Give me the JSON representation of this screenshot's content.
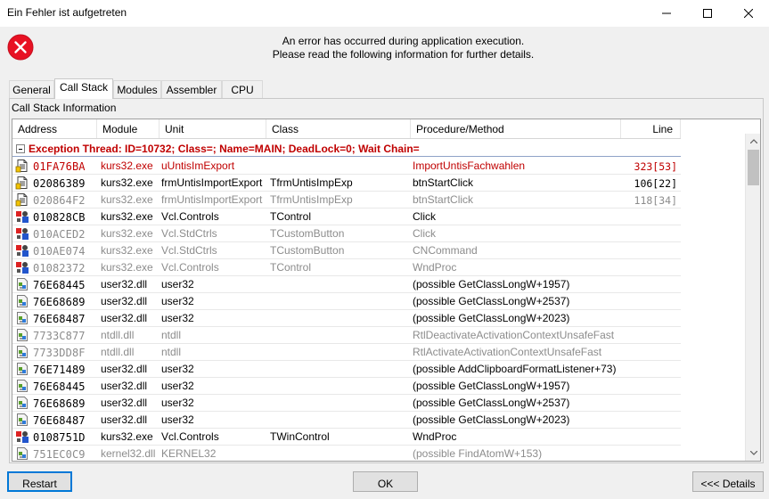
{
  "window": {
    "title": "Ein Fehler ist aufgetreten"
  },
  "message": {
    "line1": "An error has occurred during application execution.",
    "line2": "Please read the following information for further details."
  },
  "tabs": [
    {
      "label": "General"
    },
    {
      "label": "Call Stack"
    },
    {
      "label": "Modules"
    },
    {
      "label": "Assembler"
    },
    {
      "label": "CPU"
    }
  ],
  "section_label": "Call Stack Information",
  "columns": [
    "Address",
    "Module",
    "Unit",
    "Class",
    "Procedure/Method",
    "Line"
  ],
  "thread_header": "Exception Thread: ID=10732; Class=; Name=MAIN; DeadLock=0; Wait Chain=",
  "rows": [
    {
      "icon": "source-icon",
      "style": "red",
      "address": "01FA76BA",
      "module": "kurs32.exe",
      "unit": "uUntisImExport",
      "class": "",
      "proc": "ImportUntisFachwahlen",
      "line": "323[53]"
    },
    {
      "icon": "source-icon",
      "style": "normal",
      "address": "02086389",
      "module": "kurs32.exe",
      "unit": "frmUntisImportExport",
      "class": "TfrmUntisImpExp",
      "proc": "btnStartClick",
      "line": "106[22]"
    },
    {
      "icon": "source-icon",
      "style": "gray",
      "address": "020864F2",
      "module": "kurs32.exe",
      "unit": "frmUntisImportExport",
      "class": "TfrmUntisImpExp",
      "proc": "btnStartClick",
      "line": "118[34]"
    },
    {
      "icon": "vcl-icon",
      "style": "normal",
      "address": "010828CB",
      "module": "kurs32.exe",
      "unit": "Vcl.Controls",
      "class": "TControl",
      "proc": "Click",
      "line": ""
    },
    {
      "icon": "vcl-icon",
      "style": "gray",
      "address": "010ACED2",
      "module": "kurs32.exe",
      "unit": "Vcl.StdCtrls",
      "class": "TCustomButton",
      "proc": "Click",
      "line": ""
    },
    {
      "icon": "vcl-icon",
      "style": "gray",
      "address": "010AE074",
      "module": "kurs32.exe",
      "unit": "Vcl.StdCtrls",
      "class": "TCustomButton",
      "proc": "CNCommand",
      "line": ""
    },
    {
      "icon": "vcl-icon",
      "style": "gray",
      "address": "01082372",
      "module": "kurs32.exe",
      "unit": "Vcl.Controls",
      "class": "TControl",
      "proc": "WndProc",
      "line": ""
    },
    {
      "icon": "dll-icon",
      "style": "normal",
      "address": "76E68445",
      "module": "user32.dll",
      "unit": "user32",
      "class": "",
      "proc": " (possible GetClassLongW+1957)",
      "line": ""
    },
    {
      "icon": "dll-icon",
      "style": "normal",
      "address": "76E68689",
      "module": "user32.dll",
      "unit": "user32",
      "class": "",
      "proc": " (possible GetClassLongW+2537)",
      "line": ""
    },
    {
      "icon": "dll-icon",
      "style": "normal",
      "address": "76E68487",
      "module": "user32.dll",
      "unit": "user32",
      "class": "",
      "proc": " (possible GetClassLongW+2023)",
      "line": ""
    },
    {
      "icon": "dll-icon",
      "style": "gray",
      "address": "7733C877",
      "module": "ntdll.dll",
      "unit": "ntdll",
      "class": "",
      "proc": "RtlDeactivateActivationContextUnsafeFast",
      "line": ""
    },
    {
      "icon": "dll-icon",
      "style": "gray",
      "address": "7733DD8F",
      "module": "ntdll.dll",
      "unit": "ntdll",
      "class": "",
      "proc": "RtlActivateActivationContextUnsafeFast",
      "line": ""
    },
    {
      "icon": "dll-icon",
      "style": "normal",
      "address": "76E71489",
      "module": "user32.dll",
      "unit": "user32",
      "class": "",
      "proc": " (possible AddClipboardFormatListener+73)",
      "line": ""
    },
    {
      "icon": "dll-icon",
      "style": "normal",
      "address": "76E68445",
      "module": "user32.dll",
      "unit": "user32",
      "class": "",
      "proc": " (possible GetClassLongW+1957)",
      "line": ""
    },
    {
      "icon": "dll-icon",
      "style": "normal",
      "address": "76E68689",
      "module": "user32.dll",
      "unit": "user32",
      "class": "",
      "proc": " (possible GetClassLongW+2537)",
      "line": ""
    },
    {
      "icon": "dll-icon",
      "style": "normal",
      "address": "76E68487",
      "module": "user32.dll",
      "unit": "user32",
      "class": "",
      "proc": " (possible GetClassLongW+2023)",
      "line": ""
    },
    {
      "icon": "vcl-icon",
      "style": "normal",
      "address": "0108751D",
      "module": "kurs32.exe",
      "unit": "Vcl.Controls",
      "class": "TWinControl",
      "proc": "WndProc",
      "line": ""
    },
    {
      "icon": "dll-icon",
      "style": "gray",
      "address": "751EC0C9",
      "module": "kernel32.dll",
      "unit": "KERNEL32",
      "class": "",
      "proc": " (possible FindAtomW+153)",
      "line": ""
    }
  ],
  "buttons": {
    "restart": "Restart",
    "ok": "OK",
    "details": "<<< Details"
  },
  "colors": {
    "error_red": "#c00000",
    "gray_text": "#8c8c8c",
    "focus_blue": "#0078d7"
  }
}
